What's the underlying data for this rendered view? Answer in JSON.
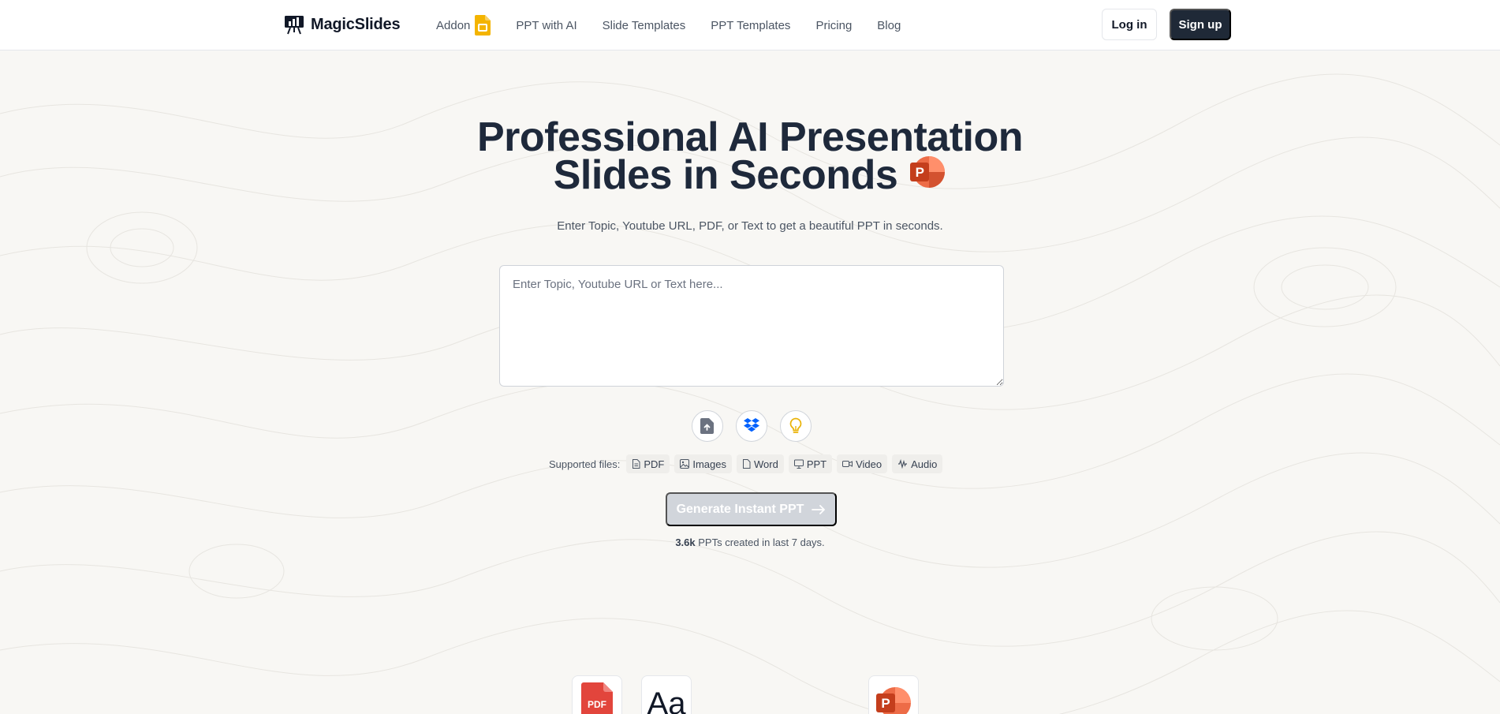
{
  "header": {
    "brand": "MagicSlides",
    "nav": [
      {
        "label": "Addon",
        "icon": "google-slides-icon"
      },
      {
        "label": "PPT with AI"
      },
      {
        "label": "Slide Templates"
      },
      {
        "label": "PPT Templates"
      },
      {
        "label": "Pricing"
      },
      {
        "label": "Blog"
      }
    ],
    "login_label": "Log in",
    "signup_label": "Sign up"
  },
  "hero": {
    "title_line1": "Professional AI Presentation",
    "title_line2": "Slides in Seconds",
    "subtitle": "Enter Topic, Youtube URL, PDF, or Text to get a beautiful PPT in seconds.",
    "input_placeholder": "Enter Topic, Youtube URL or Text here...",
    "input_value": ""
  },
  "tools": [
    {
      "icon": "file-upload-icon"
    },
    {
      "icon": "dropbox-icon"
    },
    {
      "icon": "lightbulb-icon"
    }
  ],
  "supported": {
    "label": "Supported files:",
    "types": [
      {
        "label": "PDF",
        "icon": "file-icon"
      },
      {
        "label": "Images",
        "icon": "image-icon"
      },
      {
        "label": "Word",
        "icon": "file-icon"
      },
      {
        "label": "PPT",
        "icon": "presentation-icon"
      },
      {
        "label": "Video",
        "icon": "video-icon"
      },
      {
        "label": "Audio",
        "icon": "audio-wave-icon"
      }
    ]
  },
  "generate": {
    "label": "Generate Instant PPT",
    "disabled": true
  },
  "stats": {
    "count": "3.6k",
    "text": "PPTs created in last 7 days."
  },
  "tiles": {
    "pdf_label": "PDF",
    "font_label": "Aa",
    "ppt_label": "P"
  },
  "colors": {
    "background": "#f8f7f4",
    "primary": "#1f2937",
    "disabled": "#d1d5db",
    "powerpoint": "#d24726",
    "slides_yellow": "#f4b400",
    "dropbox_blue": "#0061fe",
    "bulb_yellow": "#eab308"
  }
}
